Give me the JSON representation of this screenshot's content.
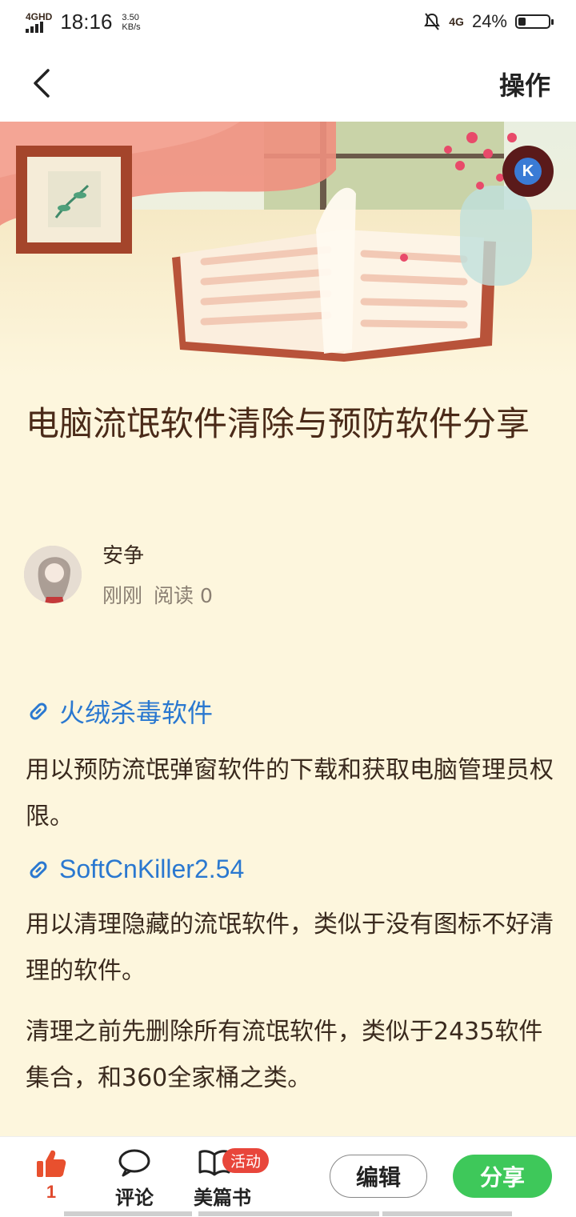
{
  "status_bar": {
    "network": "4GHD",
    "time": "18:16",
    "speed_value": "3.50",
    "speed_unit": "KB/s",
    "network_right": "4G",
    "battery_text": "24%",
    "battery_level": 0.24
  },
  "nav": {
    "back_icon": "chevron-left-icon",
    "operate_label": "操作"
  },
  "article": {
    "title": "电脑流氓软件清除与预防软件分享",
    "author_name": "安争",
    "posted": "刚刚",
    "read_label": "阅读 0",
    "links": [
      {
        "text": "火绒杀毒软件",
        "icon": "link-icon"
      },
      {
        "text": "SoftCnKiller2.54",
        "icon": "link-icon"
      }
    ],
    "paragraphs": [
      "用以预防流氓弹窗软件的下载和获取电脑管理员权限。",
      "用以清理隐藏的流氓软件，类似于没有图标不好清理的软件。",
      "清理之前先删除所有流氓软件，类似于2435软件集合，和360全家桶之类。"
    ],
    "hero_badge": "K"
  },
  "bottom_bar": {
    "like_count": "1",
    "comment_label": "评论",
    "book_label": "美篇书",
    "book_badge": "活动",
    "edit_label": "编辑",
    "share_label": "分享"
  },
  "colors": {
    "accent_green": "#3ec85a",
    "link_blue": "#2a78d0",
    "like_red": "#e04a2e",
    "page_bg": "#fdf6dd"
  }
}
